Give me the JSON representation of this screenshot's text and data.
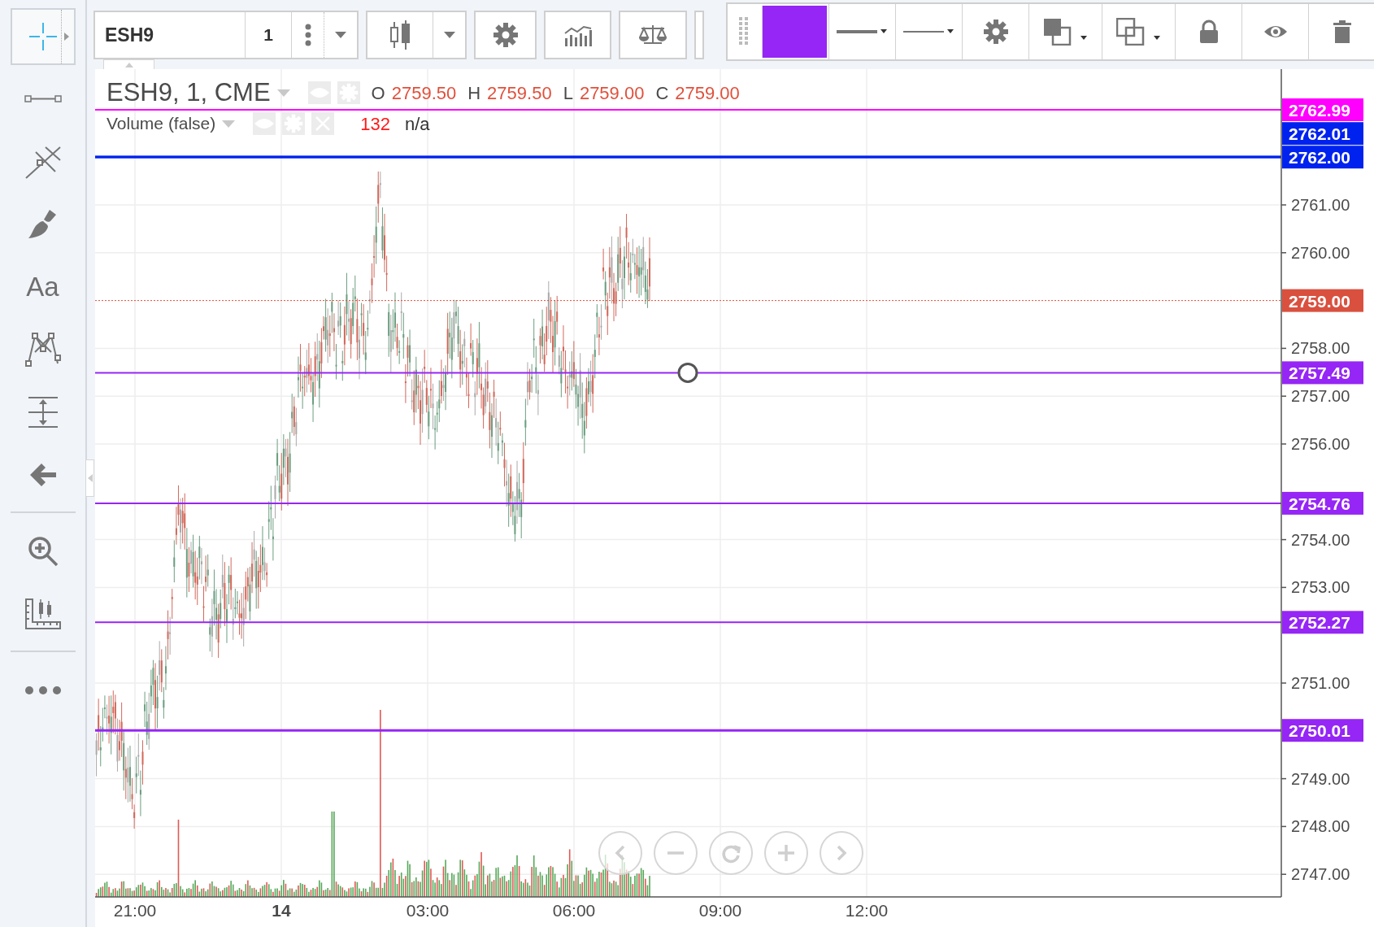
{
  "top_toolbar": {
    "symbol": "ESH9",
    "interval": "1"
  },
  "left_toolbar": {
    "tools": [
      {
        "selected": true
      },
      {
        "selected": false
      },
      {
        "selected": false
      },
      {
        "selected": false
      },
      {
        "selected": false,
        "label": "Aa"
      },
      {
        "selected": false
      },
      {
        "selected": false
      },
      {
        "selected": false
      },
      {
        "selected": false
      },
      {
        "selected": false
      },
      {
        "selected": false
      }
    ]
  },
  "legend": {
    "title": "ESH9, 1, CME",
    "ohlc": [
      {
        "key": "O",
        "value": "2759.50"
      },
      {
        "key": "H",
        "value": "2759.50"
      },
      {
        "key": "L",
        "value": "2759.00"
      },
      {
        "key": "C",
        "value": "2759.00"
      }
    ]
  },
  "volume_legend": {
    "title": "Volume (false)",
    "value": "132",
    "extra": "n/a"
  },
  "price_lines": [
    {
      "price": "2762.99",
      "color": "#ff00ff",
      "selected": false
    },
    {
      "price": "2762.01",
      "color": "#0022ee",
      "selected": false
    },
    {
      "price": "2762.00",
      "color": "#0022ee",
      "selected": false
    },
    {
      "price": "2757.49",
      "color": "#9526f5",
      "selected": true
    },
    {
      "price": "2754.76",
      "color": "#9526f5",
      "selected": false
    },
    {
      "price": "2752.27",
      "color": "#9526f5",
      "selected": false
    },
    {
      "price": "2750.01",
      "color": "#9526f5",
      "selected": false
    }
  ],
  "last_price": {
    "price": "2759.00"
  },
  "price_ticks": [
    "2761.00",
    "2760.00",
    "2758.00",
    "2757.00",
    "2756.00",
    "2754.00",
    "2753.00",
    "2751.00",
    "2749.00",
    "2748.00",
    "2747.00"
  ],
  "time_ticks": [
    {
      "label": "21:00",
      "kind": "time"
    },
    {
      "label": "14",
      "kind": "day"
    },
    {
      "label": "03:00",
      "kind": "time"
    },
    {
      "label": "06:00",
      "kind": "time"
    },
    {
      "label": "09:00",
      "kind": "time"
    },
    {
      "label": "12:00",
      "kind": "time"
    }
  ]
}
